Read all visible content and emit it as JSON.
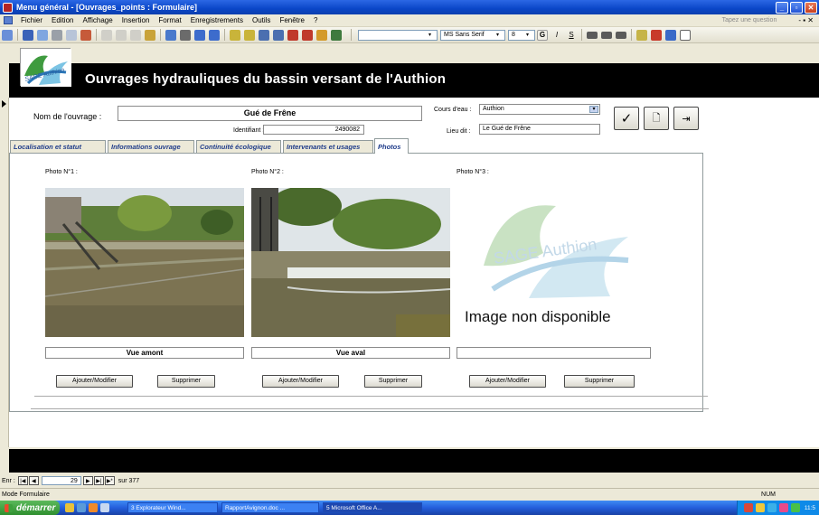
{
  "window": {
    "title": "Menu général - [Ouvrages_points : Formulaire]"
  },
  "menubar": {
    "items": [
      "Fichier",
      "Edition",
      "Affichage",
      "Insertion",
      "Format",
      "Enregistrements",
      "Outils",
      "Fenêtre",
      "?"
    ],
    "ask_placeholder": "Tapez une question",
    "right_controls": "- ▪ ✕"
  },
  "toolbar": {
    "font_name": "MS Sans Serif",
    "font_size": "8",
    "bold_label": "G",
    "italic_label": "I",
    "underline_label": "S"
  },
  "header": {
    "title": "Ouvrages hydrauliques du bassin versant de l'Authion",
    "logo_text": "SAGE Authion"
  },
  "form": {
    "nom_label": "Nom de l'ouvrage :",
    "nom_value": "Gué de Frêne",
    "identifiant_label": "Identifiant :",
    "identifiant_value": "2490082",
    "cours_label": "Cours d'eau :",
    "cours_value": "Authion",
    "lieu_label": "Lieu dit :",
    "lieu_value": "Le Gué de Frêne"
  },
  "tabs": [
    "Localisation et statut",
    "Informations ouvrage",
    "Continuité écologique",
    "Intervenants et usages",
    "Photos"
  ],
  "active_tab": "Photos",
  "photos": [
    {
      "label": "Photo N°1 :",
      "caption": "Vue amont",
      "add": "Ajouter/Modifier",
      "del": "Supprimer"
    },
    {
      "label": "Photo N°2 :",
      "caption": "Vue aval",
      "add": "Ajouter/Modifier",
      "del": "Supprimer"
    },
    {
      "label": "Photo N°3 :",
      "caption": "",
      "add": "Ajouter/Modifier",
      "del": "Supprimer",
      "placeholder_logo": "SAGE Authion",
      "placeholder_text": "Image non disponible"
    }
  ],
  "navigation": {
    "prefix": "Enr :",
    "record": "29",
    "suffix": "sur 377"
  },
  "status": {
    "mode": "Mode Formulaire",
    "num": "NUM"
  },
  "taskbar": {
    "start": "démarrer",
    "tasks": [
      "3 Explorateur Wind...",
      "RapportAvignon.doc ...",
      "5 Microsoft Office A..."
    ],
    "clock": "11:5"
  }
}
